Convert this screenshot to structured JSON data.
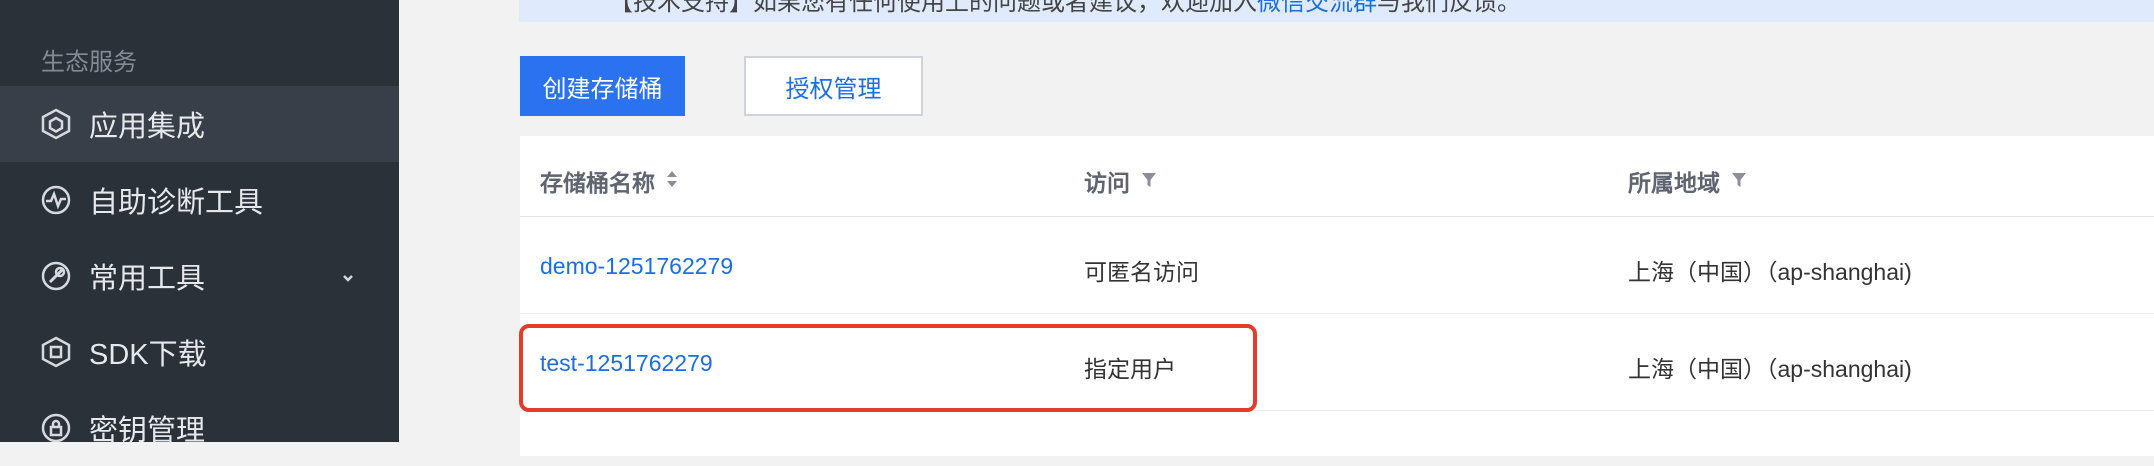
{
  "sidebar": {
    "section_label": "生态服务",
    "items": [
      {
        "label": "应用集成",
        "icon": "hexagon-integration-icon",
        "active": true
      },
      {
        "label": "自助诊断工具",
        "icon": "pulse-diagnosis-icon"
      },
      {
        "label": "常用工具",
        "icon": "tools-icon",
        "has_submenu": true
      },
      {
        "label": "SDK下载",
        "icon": "sdk-package-icon"
      },
      {
        "label": "密钥管理",
        "icon": "key-lock-icon"
      }
    ]
  },
  "notice": {
    "text": "【技术支持】如果您有任何使用上的问题或者建议，欢迎加入",
    "link": "微信交流群",
    "tail": "与我们反馈。"
  },
  "toolbar": {
    "create_label": "创建存储桶",
    "auth_label": "授权管理"
  },
  "table": {
    "columns": [
      {
        "label": "存储桶名称",
        "icon": "sort-icon"
      },
      {
        "label": "访问",
        "icon": "filter-icon"
      },
      {
        "label": "所属地域",
        "icon": "filter-icon"
      }
    ],
    "rows": [
      {
        "name": "demo-1251762279",
        "access": "可匿名访问",
        "region": "上海（中国）（ap-shanghai)"
      },
      {
        "name": "test-1251762279",
        "access": "指定用户",
        "region": "上海（中国）（ap-shanghai)"
      }
    ]
  },
  "colors": {
    "primary": "#2a72f0",
    "link": "#1a6ee6",
    "highlight": "#e23c2b",
    "sidebar_bg": "#2b3139"
  }
}
